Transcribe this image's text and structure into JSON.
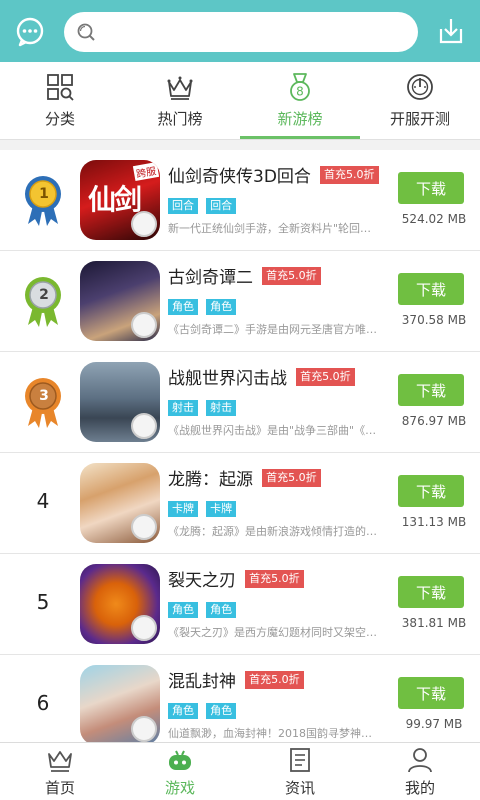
{
  "search": {
    "placeholder": "",
    "value": ""
  },
  "tabs": [
    {
      "label": "分类",
      "icon": "grid-search-icon",
      "active": false
    },
    {
      "label": "热门榜",
      "icon": "crown-icon",
      "active": false
    },
    {
      "label": "新游榜",
      "icon": "medal-icon",
      "active": true
    },
    {
      "label": "开服开测",
      "icon": "gauge-icon",
      "active": false
    }
  ],
  "games": [
    {
      "rank": "1",
      "rank_style": "ribbon-blue",
      "name": "仙剑奇侠传3D回合",
      "promo": "首充5.0折",
      "tags": [
        "回合",
        "回合"
      ],
      "desc": "新一代正统仙剑手游，全新资料片\"轮回…",
      "download_label": "下载",
      "size": "524.02 MB",
      "icon_text": "仙剑",
      "icon_badge": "跨服"
    },
    {
      "rank": "2",
      "rank_style": "ribbon-green",
      "name": "古剑奇谭二",
      "promo": "首充5.0折",
      "tags": [
        "角色",
        "角色"
      ],
      "desc": "《古剑奇谭二》手游是由网元圣唐官方唯…",
      "download_label": "下载",
      "size": "370.58 MB"
    },
    {
      "rank": "3",
      "rank_style": "ribbon-orange",
      "name": "战舰世界闪击战",
      "promo": "首充5.0折",
      "tags": [
        "射击",
        "射击"
      ],
      "desc": "《战舰世界闪击战》是由\"战争三部曲\"《…",
      "download_label": "下载",
      "size": "876.97 MB"
    },
    {
      "rank": "4",
      "rank_style": "number",
      "name": "龙腾：起源",
      "promo": "首充5.0折",
      "tags": [
        "卡牌",
        "卡牌"
      ],
      "desc": "《龙腾：起源》是由新浪游戏倾情打造的…",
      "download_label": "下载",
      "size": "131.13 MB"
    },
    {
      "rank": "5",
      "rank_style": "number",
      "name": "裂天之刃",
      "promo": "首充5.0折",
      "tags": [
        "角色",
        "角色"
      ],
      "desc": "《裂天之刃》是西方魔幻题材同时又架空…",
      "download_label": "下载",
      "size": "381.81 MB"
    },
    {
      "rank": "6",
      "rank_style": "number",
      "name": "混乱封神",
      "promo": "首充5.0折",
      "tags": [
        "角色",
        "角色"
      ],
      "desc": "仙道飘渺，血海封神！2018国韵寻梦神…",
      "download_label": "下载",
      "size": "99.97 MB"
    }
  ],
  "bottom_nav": [
    {
      "label": "首页",
      "icon": "crown-outline-icon",
      "active": false
    },
    {
      "label": "游戏",
      "icon": "gamepad-icon",
      "active": true
    },
    {
      "label": "资讯",
      "icon": "news-icon",
      "active": false
    },
    {
      "label": "我的",
      "icon": "user-icon",
      "active": false
    }
  ],
  "colors": {
    "header": "#5dc6c6",
    "accent_green": "#70bf41",
    "promo_red": "#e35452",
    "tag_blue": "#38bfe0"
  }
}
